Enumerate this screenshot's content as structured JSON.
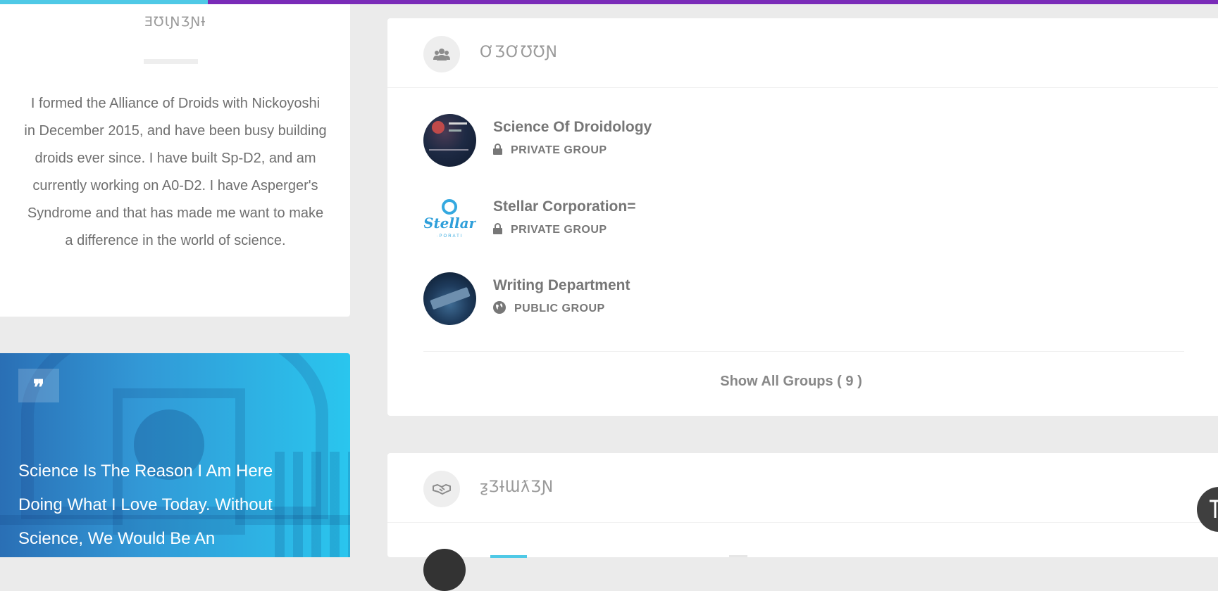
{
  "about": {
    "title": "ƎƱƖƝƷƝƗ",
    "text": "I formed the Alliance of Droids with Nickoyoshi in December 2015, and have been busy building droids ever since. I have built Sp-D2, and am currently working on A0-D2. I have Asperger's Syndrome and that has made me want to make a difference in the world of science."
  },
  "quote": {
    "icon": "quote-icon",
    "text": "Science Is The Reason I Am Here Doing What I Love Today. Without Science, We Would Be An"
  },
  "groups": {
    "title": "ƠƷƠƱƱƝ",
    "icon": "users-icon",
    "items": [
      {
        "name": "Science Of Droidology",
        "type": "PRIVATE GROUP",
        "icon": "lock-icon"
      },
      {
        "name": "Stellar Corporation=",
        "type": "PRIVATE GROUP",
        "icon": "lock-icon"
      },
      {
        "name": "Writing Department",
        "type": "PUBLIC GROUP",
        "icon": "globe-icon"
      }
    ],
    "show_all": "Show All Groups ( 9 )"
  },
  "friends": {
    "title": "ƺƷƗƜƛƷƝ",
    "icon": "handshake-icon"
  },
  "colors": {
    "accent_purple": "#7a2bb8",
    "accent_cyan": "#4fc9e6",
    "scroll_button": "#3f3f3f"
  }
}
